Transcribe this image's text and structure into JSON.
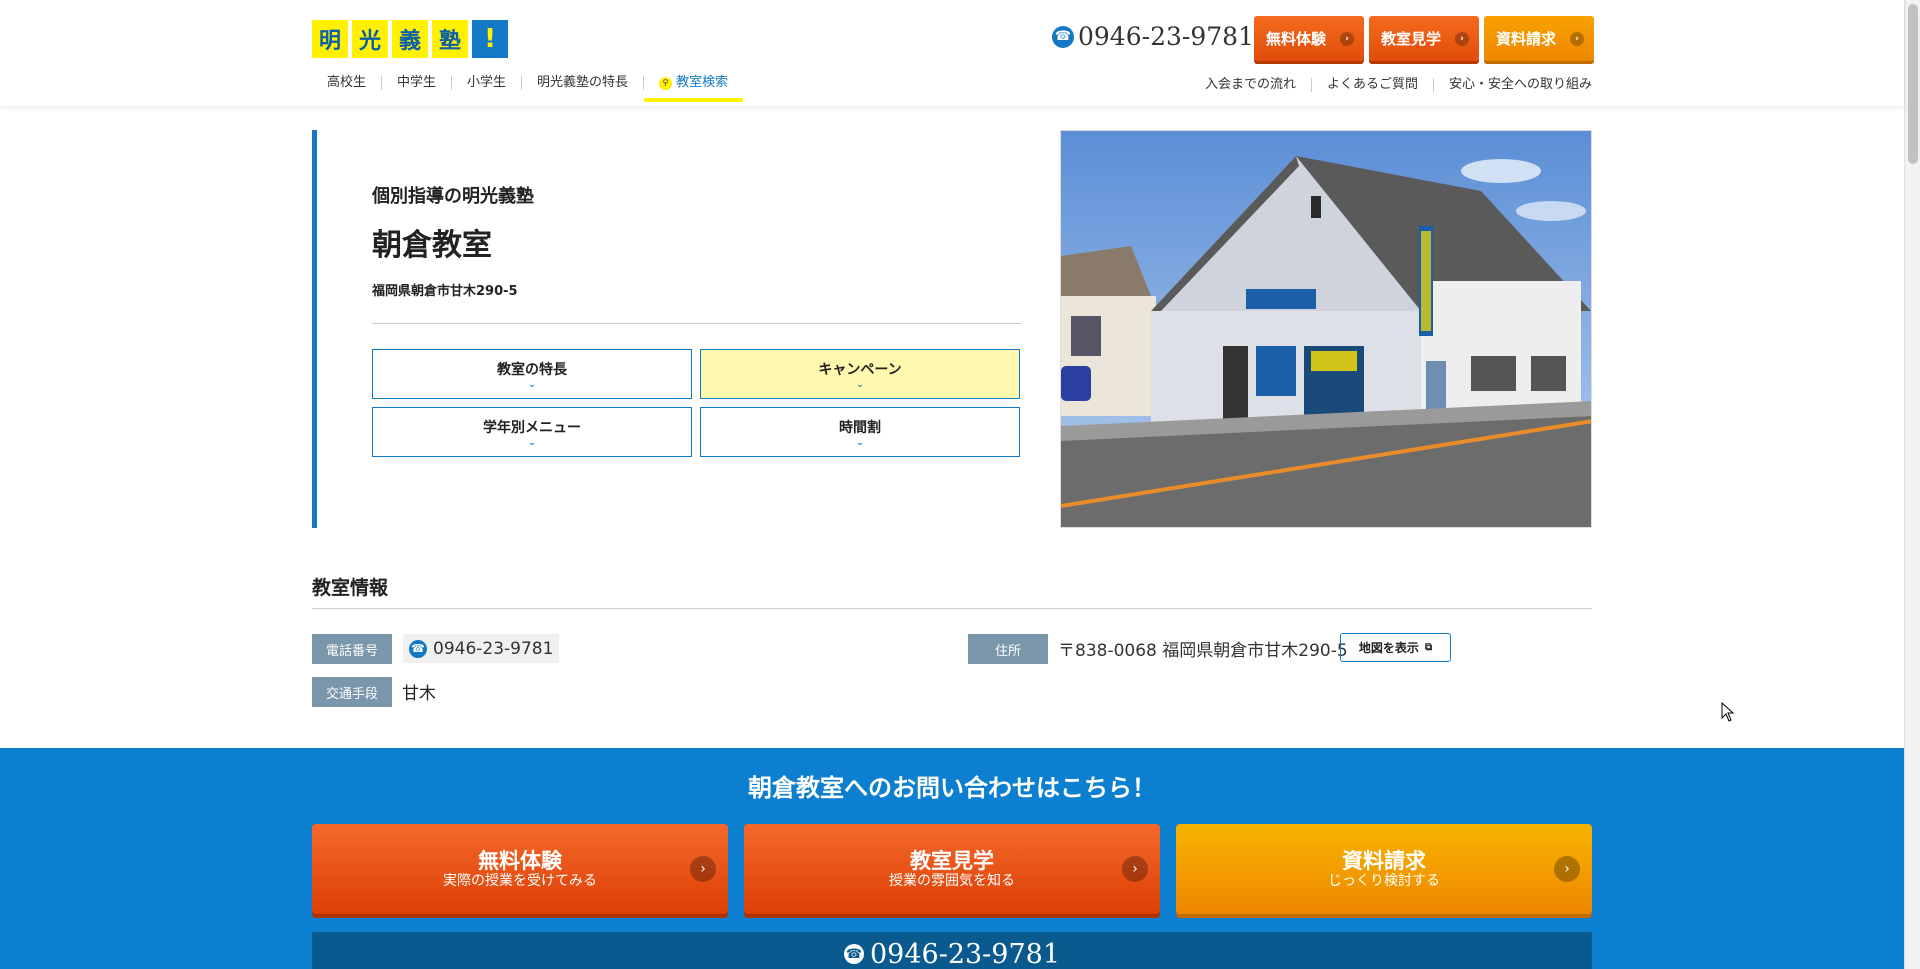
{
  "header": {
    "logo_chars": [
      "明",
      "光",
      "義",
      "塾",
      "!"
    ],
    "phone": "0946-23-9781",
    "buttons": [
      {
        "label": "無料体験",
        "style": "orange"
      },
      {
        "label": "教室見学",
        "style": "orange"
      },
      {
        "label": "資料請求",
        "style": "yellow"
      }
    ],
    "nav": [
      "高校生",
      "中学生",
      "小学生",
      "明光義塾の特長",
      "教室検索"
    ],
    "sub_nav": [
      "入会までの流れ",
      "よくあるご質問",
      "安心・安全への取り組み"
    ]
  },
  "hero": {
    "subtitle": "個別指導の明光義塾",
    "title": "朝倉教室",
    "address": "福岡県朝倉市甘木290-5",
    "buttons": [
      "教室の特長",
      "キャンペーン",
      "学年別メニュー",
      "時間割"
    ]
  },
  "info": {
    "title": "教室情報",
    "phone_label": "電話番号",
    "phone": "0946-23-9781",
    "address_label": "住所",
    "address": "〒838-0068 福岡県朝倉市甘木290-5",
    "map_button": "地図を表示",
    "transport_label": "交通手段",
    "transport": "甘木"
  },
  "cta": {
    "title": "朝倉教室へのお問い合わせはこちら！",
    "buttons": [
      {
        "title": "無料体験",
        "sub": "実際の授業を受けてみる"
      },
      {
        "title": "教室見学",
        "sub": "授業の雰囲気を知る"
      },
      {
        "title": "資料請求",
        "sub": "じっくり検討する"
      }
    ],
    "phone": "0946-23-9781"
  },
  "colors": {
    "brand_blue": "#1479c4",
    "brand_yellow": "#fff100",
    "cta_orange": "#e04d0a",
    "cta_yellow": "#ee8600",
    "cta_bg": "#0c7fd0"
  },
  "icons": [
    "phone-icon",
    "search-icon",
    "chevron-right-icon",
    "chevron-down-icon",
    "external-link-icon"
  ]
}
